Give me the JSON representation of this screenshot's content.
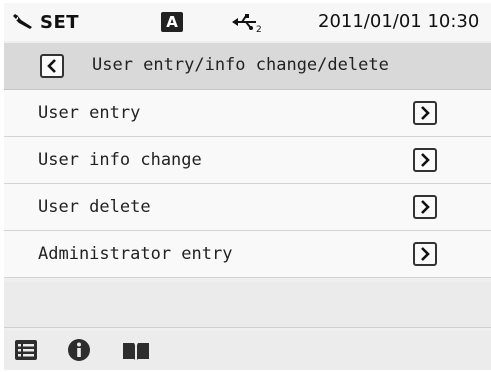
{
  "status": {
    "mode_label": "SET",
    "badge": "A",
    "datetime": "2011/01/01 10:30",
    "icons": [
      "wrench-icon",
      "usb-icon"
    ]
  },
  "header": {
    "title": "User entry/info change/delete",
    "back_icon": "chevron-left-icon"
  },
  "menu": {
    "items": [
      {
        "label": "User entry",
        "icon": "chevron-right-icon"
      },
      {
        "label": "User info change",
        "icon": "chevron-right-icon"
      },
      {
        "label": "User delete",
        "icon": "chevron-right-icon"
      },
      {
        "label": "Administrator entry",
        "icon": "chevron-right-icon"
      }
    ]
  },
  "footer": {
    "icons": [
      "list-icon",
      "info-icon",
      "book-icon"
    ]
  }
}
